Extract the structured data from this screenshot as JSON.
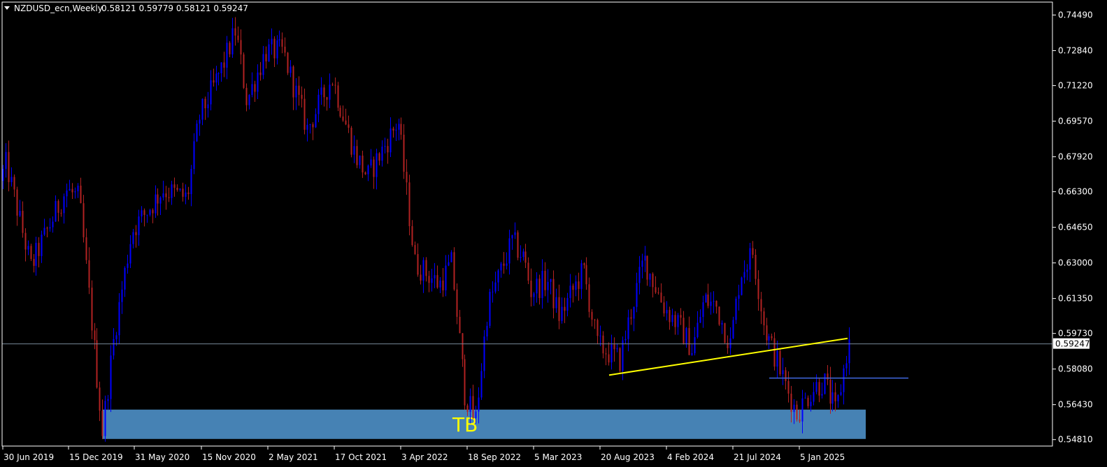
{
  "header": {
    "symbol": "NZDUSD_ecn,Weekly",
    "ohlc": "0.58121 0.59779 0.58121 0.59247"
  },
  "colors": {
    "background": "#000000",
    "frame": "#ffffff",
    "bull": "#0000ff",
    "bear": "#b22222",
    "trendline": "#ffff00",
    "level_line": "#4169e1",
    "zone_fill": "#4682b4",
    "price_line": "#778899"
  },
  "chart_data": {
    "type": "candlestick",
    "title": "NZDUSD_ecn,Weekly",
    "ylim": [
      0.5451,
      0.7509
    ],
    "x_ticks": [
      "30 Jun 2019",
      "15 Dec 2019",
      "31 May 2020",
      "15 Nov 2020",
      "2 May 2021",
      "17 Oct 2021",
      "3 Apr 2022",
      "18 Sep 2022",
      "5 Mar 2023",
      "20 Aug 2023",
      "4 Feb 2024",
      "21 Jul 2024",
      "5 Jan 2025"
    ],
    "y_ticks": [
      "0.74490",
      "0.72840",
      "0.71220",
      "0.69570",
      "0.67920",
      "0.66300",
      "0.64650",
      "0.63000",
      "0.61350",
      "0.59730",
      "0.58080",
      "0.56430",
      "0.54810"
    ],
    "current_price": "0.59247",
    "price_series": [
      {
        "date": "30 Jun 2019",
        "close": 0.668
      },
      {
        "date": "Jul 2019",
        "close": 0.676
      },
      {
        "date": "Sep 2019",
        "close": 0.628
      },
      {
        "date": "15 Dec 2019",
        "close": 0.664
      },
      {
        "date": "Jan 2020",
        "close": 0.66
      },
      {
        "date": "Mar 2020",
        "close": 0.552
      },
      {
        "date": "Apr 2020",
        "close": 0.598
      },
      {
        "date": "31 May 2020",
        "close": 0.645
      },
      {
        "date": "Aug 2020",
        "close": 0.664
      },
      {
        "date": "Oct 2020",
        "close": 0.66
      },
      {
        "date": "15 Nov 2020",
        "close": 0.697
      },
      {
        "date": "Jan 2021",
        "close": 0.722
      },
      {
        "date": "Feb 2021",
        "close": 0.738
      },
      {
        "date": "Mar 2021",
        "close": 0.705
      },
      {
        "date": "2 May 2021",
        "close": 0.728
      },
      {
        "date": "Jun 2021",
        "close": 0.728
      },
      {
        "date": "Aug 2021",
        "close": 0.692
      },
      {
        "date": "17 Oct 2021",
        "close": 0.716
      },
      {
        "date": "Dec 2021",
        "close": 0.68
      },
      {
        "date": "Jan 2022",
        "close": 0.67
      },
      {
        "date": "3 Apr 2022",
        "close": 0.696
      },
      {
        "date": "May 2022",
        "close": 0.63
      },
      {
        "date": "Jul 2022",
        "close": 0.62
      },
      {
        "date": "Aug 2022",
        "close": 0.63
      },
      {
        "date": "18 Sep 2022",
        "close": 0.57
      },
      {
        "date": "Oct 2022",
        "close": 0.556
      },
      {
        "date": "Nov 2022",
        "close": 0.61
      },
      {
        "date": "Jan 2023",
        "close": 0.64
      },
      {
        "date": "Feb 2023",
        "close": 0.632
      },
      {
        "date": "5 Mar 2023",
        "close": 0.617
      },
      {
        "date": "Apr 2023",
        "close": 0.622
      },
      {
        "date": "May 2023",
        "close": 0.605
      },
      {
        "date": "Jul 2023",
        "close": 0.627
      },
      {
        "date": "20 Aug 2023",
        "close": 0.592
      },
      {
        "date": "Oct 2023",
        "close": 0.585
      },
      {
        "date": "Nov 2023",
        "close": 0.61
      },
      {
        "date": "Dec 2023",
        "close": 0.632
      },
      {
        "date": "4 Feb 2024",
        "close": 0.61
      },
      {
        "date": "Mar 2024",
        "close": 0.6
      },
      {
        "date": "Apr 2024",
        "close": 0.59
      },
      {
        "date": "May 2024",
        "close": 0.613
      },
      {
        "date": "Jun 2024",
        "close": 0.61
      },
      {
        "date": "21 Jul 2024",
        "close": 0.592
      },
      {
        "date": "Aug 2024",
        "close": 0.625
      },
      {
        "date": "Sep 2024",
        "close": 0.635
      },
      {
        "date": "Oct 2024",
        "close": 0.6
      },
      {
        "date": "Nov 2024",
        "close": 0.585
      },
      {
        "date": "Dec 2024",
        "close": 0.57
      },
      {
        "date": "5 Jan 2025",
        "close": 0.56
      },
      {
        "date": "Feb 2025",
        "close": 0.572
      },
      {
        "date": "Mar 2025",
        "close": 0.575
      },
      {
        "date": "Apr 2025",
        "close": 0.56
      },
      {
        "date": "May 2025",
        "close": 0.592
      }
    ],
    "trendline": {
      "from": {
        "date": "20 Aug 2023",
        "price": 0.578
      },
      "to": {
        "date": "May 2025",
        "price": 0.595
      }
    },
    "level_line": {
      "price": 0.5766,
      "from_date": "Oct 2024",
      "to_date": "Sep 2025"
    },
    "zone": {
      "label": "TB",
      "price_low": 0.5484,
      "price_high": 0.562,
      "from_date": "Jan 2020",
      "to_date": "Jul 2025"
    }
  }
}
